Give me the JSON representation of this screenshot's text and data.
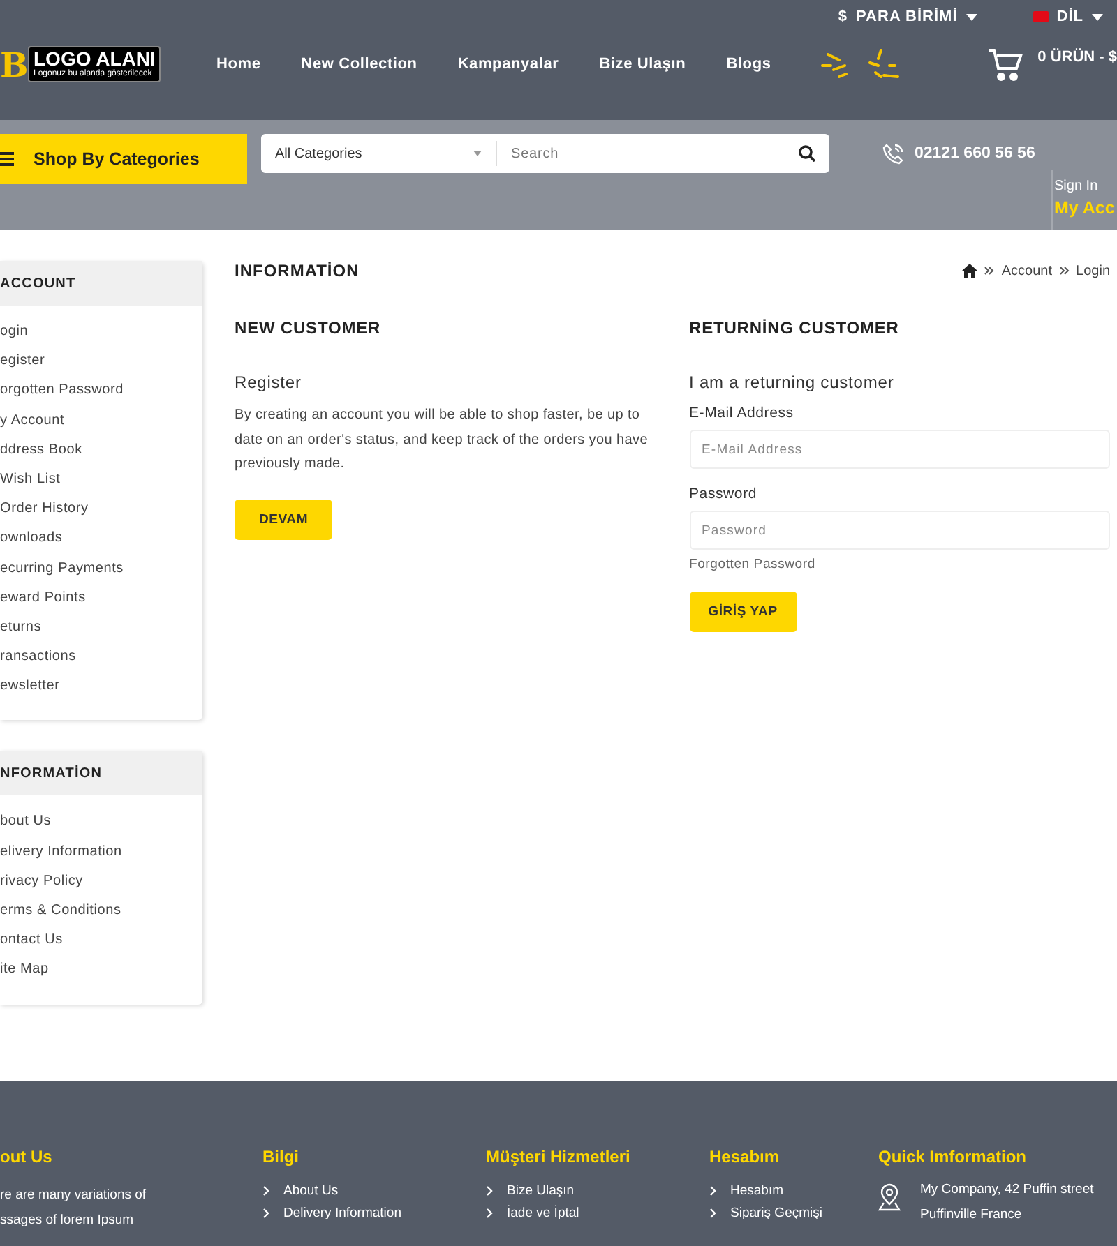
{
  "top_bar": {
    "currency_symbol": "$",
    "currency": "PARA BİRİMİ",
    "language": "DİL"
  },
  "header": {
    "logo": {
      "letter": "B",
      "title": "LOGO ALANI",
      "subtitle": "Logonuz bu alanda gösterilecek"
    },
    "nav": [
      "Home",
      "New Collection",
      "Kampanyalar",
      "Bize Ulaşın",
      "Blogs"
    ],
    "cart": "0 ÜRÜN - $"
  },
  "search_bar": {
    "categories_button": "Shop By Categories",
    "category_select": "All Categories",
    "placeholder": "Search",
    "phone": "02121 660 56 56",
    "sign_in": "Sign In",
    "account": "My Acc"
  },
  "sidebar": [
    {
      "title": "ACCOUNT",
      "items": [
        "ogin",
        "egister",
        "orgotten Password",
        "y Account",
        "ddress Book",
        "Wish List",
        "Order History",
        "ownloads",
        "ecurring Payments",
        "eward Points",
        "eturns",
        "ransactions",
        "ewsletter"
      ]
    },
    {
      "title": "NFORMATİON",
      "items": [
        "bout Us",
        "elivery Information",
        "rivacy Policy",
        "erms & Conditions",
        "ontact Us",
        "ite Map"
      ]
    }
  ],
  "page": {
    "title": "INFORMATİON",
    "breadcrumb": [
      "Account",
      "Login"
    ],
    "new_customer": {
      "heading": "NEW CUSTOMER",
      "subheading": "Register",
      "text": "By creating an account you will be able to shop faster, be up to date on an order's status, and keep track of the orders you have previously made.",
      "button": "DEVAM"
    },
    "returning_customer": {
      "heading": "RETURNİNG CUSTOMER",
      "subheading": "I am a returning customer",
      "fields": [
        {
          "label": "E-Mail Address",
          "placeholder": "E-Mail Address"
        },
        {
          "label": "Password",
          "placeholder": "Password"
        }
      ],
      "forgotten_link": "Forgotten Password",
      "button": "GİRİŞ YAP"
    }
  },
  "footer": {
    "columns": [
      {
        "kind": "text",
        "title": "out Us",
        "lines": [
          "re are many variations of",
          "ssages of lorem Ipsum"
        ]
      },
      {
        "kind": "links",
        "title": "Bilgi",
        "items": [
          "About Us",
          "Delivery Information"
        ]
      },
      {
        "kind": "links",
        "title": "Müşteri Hizmetleri",
        "items": [
          "Bize Ulaşın",
          "İade ve İptal"
        ]
      },
      {
        "kind": "links",
        "title": "Hesabım",
        "items": [
          "Hesabım",
          "Sipariş Geçmişi"
        ]
      },
      {
        "kind": "contact",
        "title": "Quick Imformation",
        "address": "My Company, 42 Puffin street Puffinville France"
      }
    ]
  }
}
